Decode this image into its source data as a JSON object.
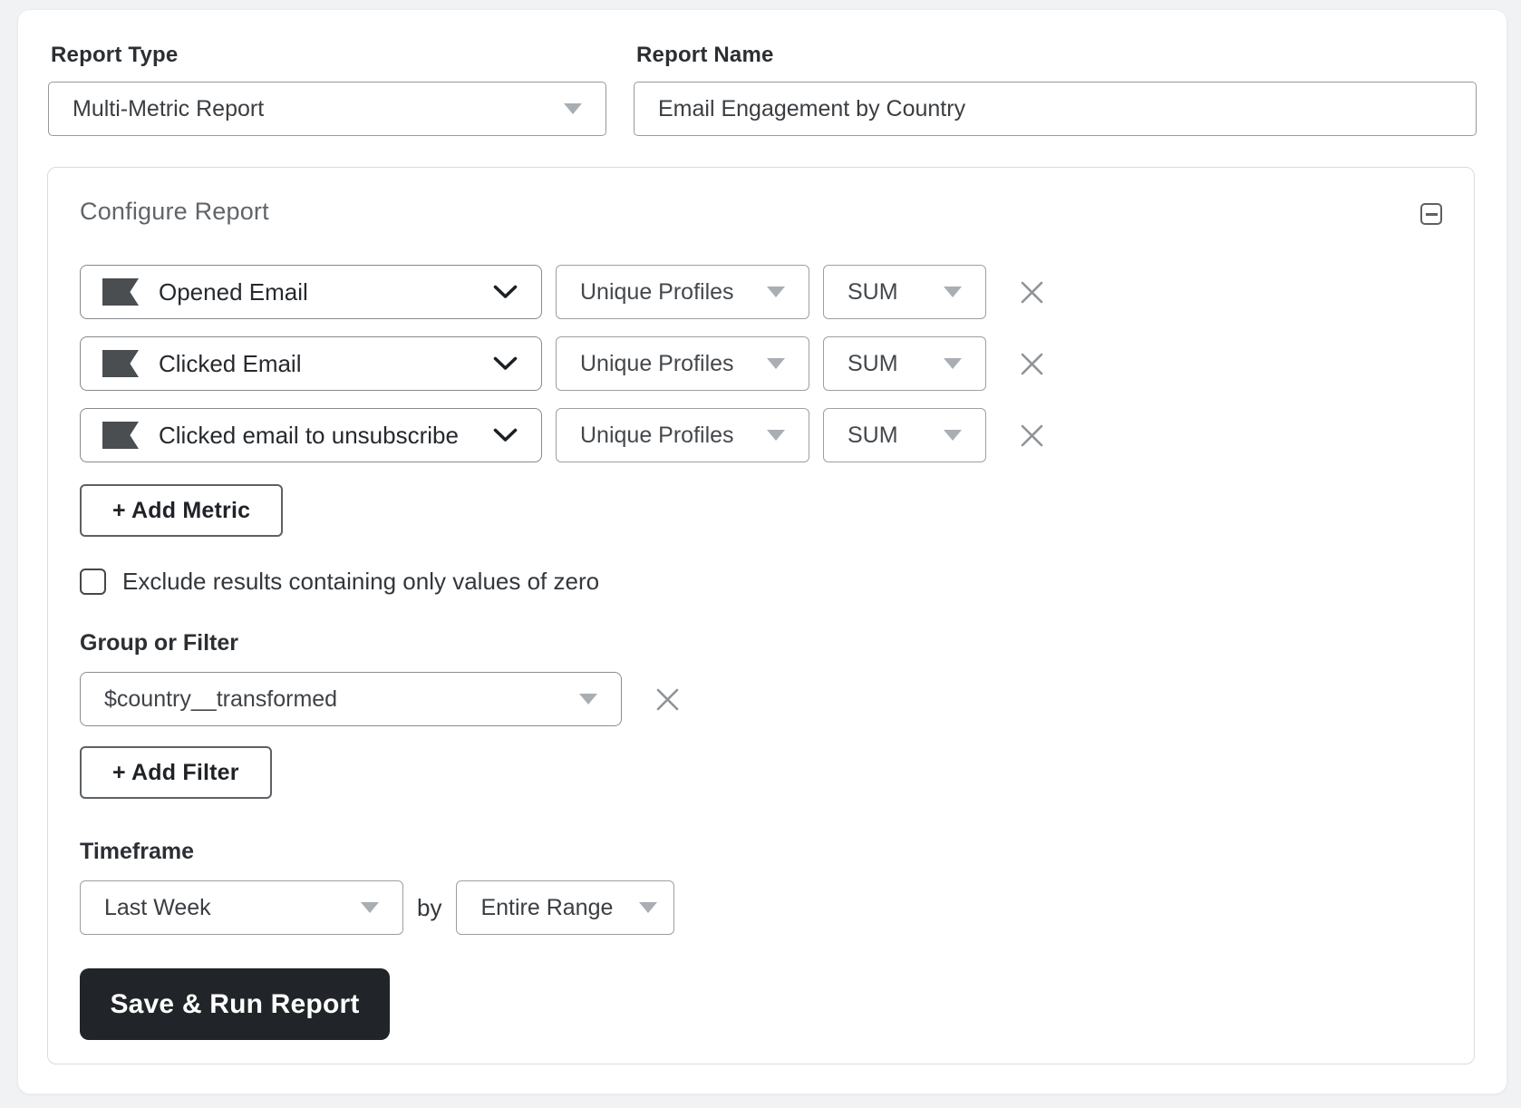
{
  "header": {
    "report_type_label": "Report Type",
    "report_type_value": "Multi-Metric Report",
    "report_name_label": "Report Name",
    "report_name_value": "Email Engagement by Country"
  },
  "configure": {
    "title": "Configure Report",
    "metrics": [
      {
        "name": "Opened Email",
        "measurement": "Unique Profiles",
        "aggregate": "SUM"
      },
      {
        "name": "Clicked Email",
        "measurement": "Unique Profiles",
        "aggregate": "SUM"
      },
      {
        "name": "Clicked email to unsubscribe",
        "measurement": "Unique Profiles",
        "aggregate": "SUM"
      }
    ],
    "add_metric_label": "+ Add Metric",
    "exclude_zero_label": "Exclude results containing only values of zero",
    "exclude_zero_checked": false,
    "group_filter_label": "Group or Filter",
    "group_filter_value": "$country__transformed",
    "add_filter_label": "+ Add Filter",
    "timeframe_label": "Timeframe",
    "timeframe_value": "Last Week",
    "timeframe_by_text": "by",
    "timeframe_interval_value": "Entire Range",
    "save_button_label": "Save & Run Report"
  },
  "icons": {
    "collapse": "minus-square-icon",
    "metric": "flag-icon",
    "metric_dropdown": "chevron-down-icon",
    "dropdown": "caret-down-icon",
    "remove": "x-icon"
  },
  "colors": {
    "save_button_bg": "#212529",
    "save_button_text": "#ffffff",
    "metric_icon": "#4a4e51",
    "caret_gray": "#a9aeb3",
    "chevron_dark": "#1c2023",
    "x_gray": "#8f9498"
  }
}
